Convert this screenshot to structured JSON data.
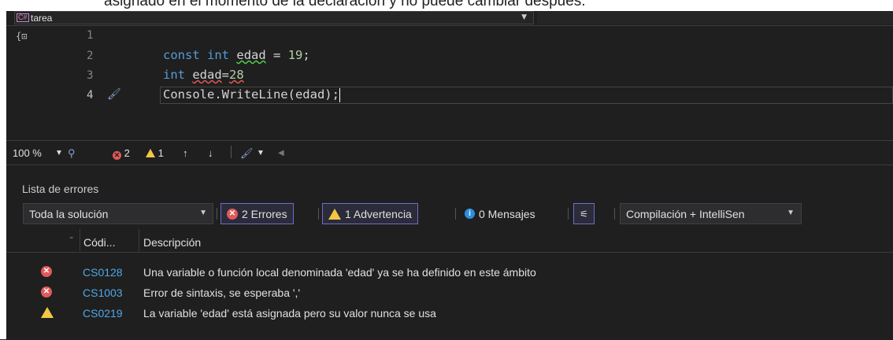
{
  "header": {
    "partial_text": "asignado en el momento de la declaración y no puede cambiar después."
  },
  "file_bar": {
    "language_badge": "C#",
    "file_name": "tarea"
  },
  "editor": {
    "line_numbers": [
      "1",
      "2",
      "3",
      "4"
    ],
    "lines": [
      "",
      "const int edad = 19;",
      "int edad=28",
      "Console.WriteLine(edad);"
    ],
    "tokens": {
      "l2_kw1": "const",
      "l2_kw2": "int",
      "l2_id": "edad",
      "l2_op": " = ",
      "l2_num": "19",
      "l2_end": ";",
      "l3_kw": "int",
      "l3_id": "edad",
      "l3_op": "=",
      "l3_num": "28",
      "l4_text": "Console.WriteLine(edad);"
    }
  },
  "status_bar": {
    "zoom": "100 %",
    "error_count": "2",
    "warning_count": "1"
  },
  "error_list": {
    "title": "Lista de errores",
    "scope": "Toda la solución",
    "errors_filter": "2 Errores",
    "warnings_filter": "1 Advertencia",
    "messages_filter": "0 Mensajes",
    "build_filter": "Compilación + IntelliSen",
    "columns": {
      "code": "Códi...",
      "description": "Descripción"
    },
    "rows": [
      {
        "severity": "error",
        "code": "CS0128",
        "description": "Una variable o función local denominada 'edad' ya se ha definido en este ámbito"
      },
      {
        "severity": "error",
        "code": "CS1003",
        "description": "Error de sintaxis, se esperaba ','"
      },
      {
        "severity": "warning",
        "code": "CS0219",
        "description": "La variable 'edad' está asignada pero su valor nunca se usa"
      }
    ]
  },
  "colors": {
    "background": "#1f1f1f",
    "keyword": "#569cd6",
    "number": "#b5cea8",
    "error": "#e05a5a",
    "warning": "#f2c744",
    "link": "#4fa8e8",
    "filter_border": "#6e6ec6"
  }
}
